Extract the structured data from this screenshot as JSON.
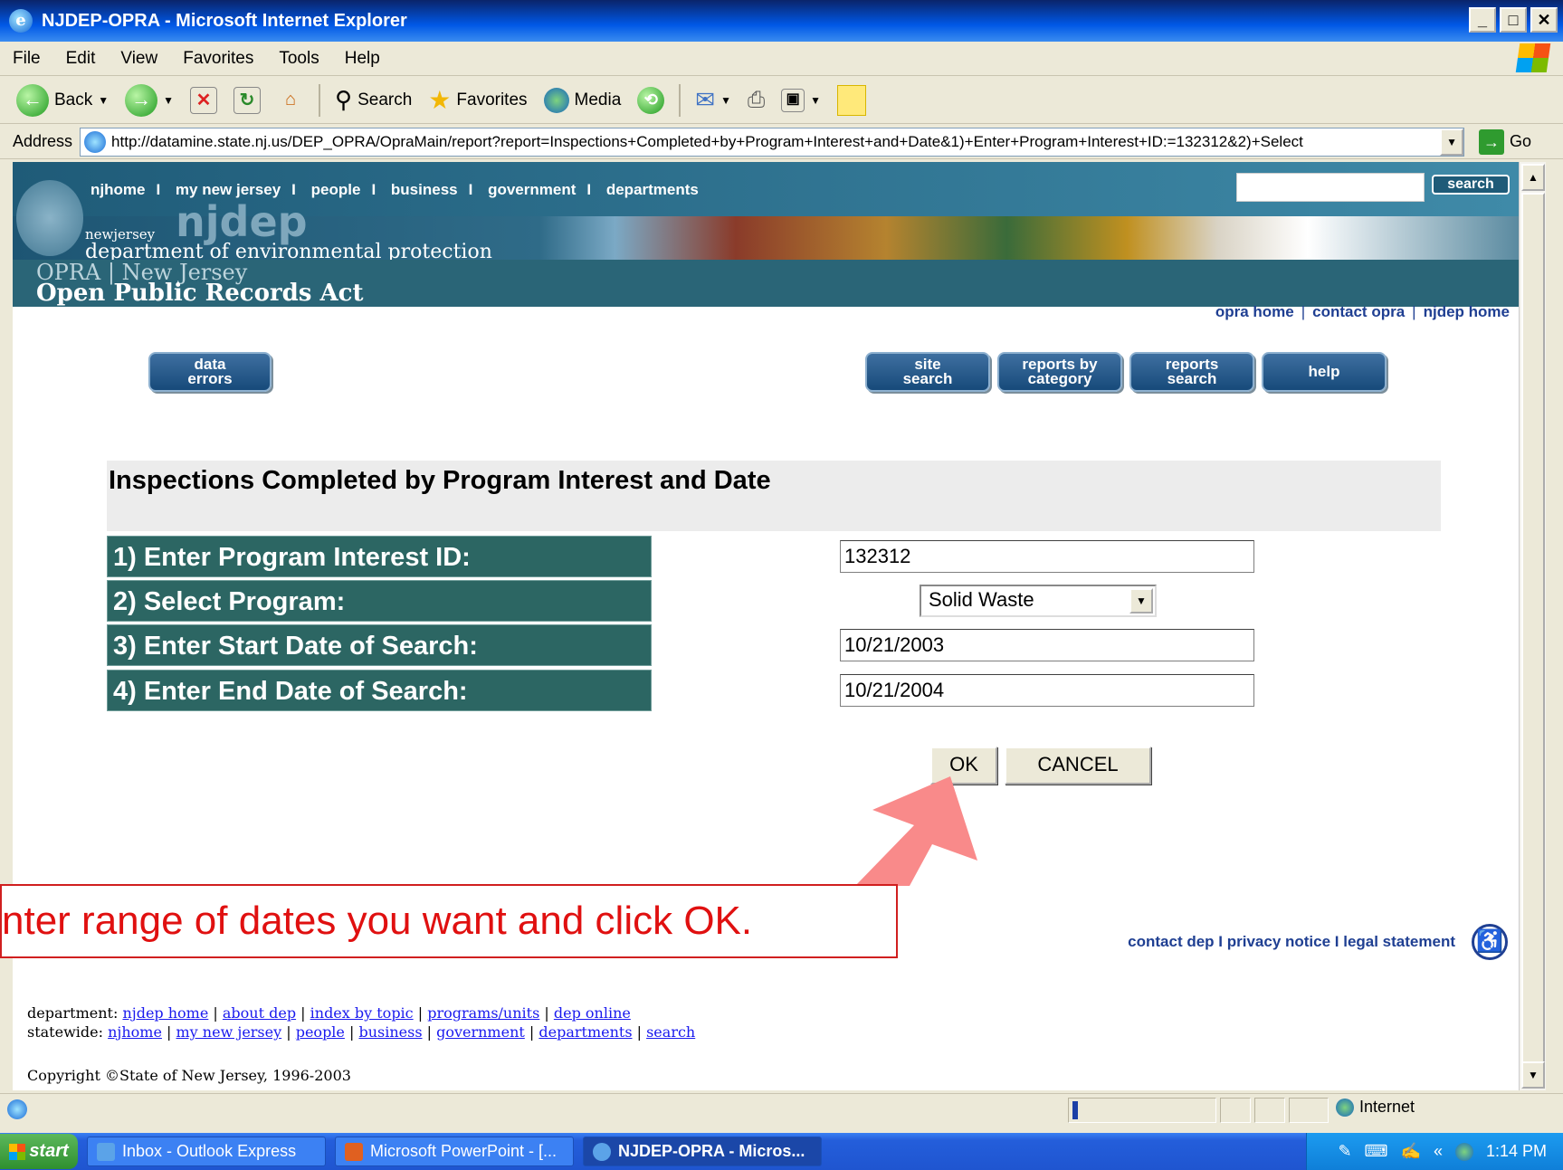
{
  "window": {
    "title": "NJDEP-OPRA - Microsoft Internet Explorer",
    "min": "_",
    "max": "□",
    "close": "✕"
  },
  "menu": [
    "File",
    "Edit",
    "View",
    "Favorites",
    "Tools",
    "Help"
  ],
  "toolbar": {
    "back": "Back",
    "search": "Search",
    "favorites": "Favorites",
    "media": "Media"
  },
  "address": {
    "label": "Address",
    "url": "http://datamine.state.nj.us/DEP_OPRA/OpraMain/report?report=Inspections+Completed+by+Program+Interest+and+Date&1)+Enter+Program+Interest+ID:=132312&2)+Select",
    "go": "Go"
  },
  "site": {
    "nav_links": [
      "njhome",
      "my new jersey",
      "people",
      "business",
      "government",
      "departments"
    ],
    "nav_sep": "I",
    "search_button": "search",
    "dept_small": "newjersey",
    "dept_logo": "njdep",
    "dept_name": "department of environmental protection",
    "opra_line1": "OPRA | New Jersey",
    "opra_line2": "Open Public Records Act",
    "top_links": [
      "opra home",
      "contact opra",
      "njdep home"
    ],
    "top_sep": "|",
    "buttons": {
      "data_errors": "data errors",
      "site_search": "site search",
      "reports_by_category": "reports by category",
      "reports_search": "reports search",
      "help": "help"
    }
  },
  "form": {
    "title": "Inspections Completed by Program Interest and Date",
    "labels": [
      "1) Enter Program Interest ID:",
      "2) Select Program:",
      "3) Enter Start Date of Search:",
      "4) Enter End Date of Search:"
    ],
    "program_interest_id": "132312",
    "program": "Solid Waste",
    "start_date": "10/21/2003",
    "end_date": "10/21/2004",
    "ok": "OK",
    "cancel": "CANCEL"
  },
  "footer": {
    "links": "contact dep I privacy notice I legal statement",
    "dept_label": "department:",
    "dept_links": [
      "njdep home",
      "about dep",
      "index by topic",
      "programs/units",
      "dep online"
    ],
    "statewide_label": "statewide:",
    "statewide_links": [
      "njhome",
      "my new jersey",
      "people",
      "business",
      "government",
      "departments",
      "search"
    ],
    "copyright": "Copyright ©State of New Jersey, 1996-2003"
  },
  "callout": {
    "text": "nter range of dates you want and click OK."
  },
  "status": {
    "zone": "Internet"
  },
  "taskbar": {
    "start": "start",
    "tasks": [
      "Inbox - Outlook Express",
      "Microsoft PowerPoint - [...",
      "NJDEP-OPRA - Micros..."
    ],
    "clock": "1:14 PM"
  },
  "colors": {
    "form_label_bg": "#2c6663",
    "callout_red": "#e01010",
    "arrow_pink": "#f98a8a"
  }
}
